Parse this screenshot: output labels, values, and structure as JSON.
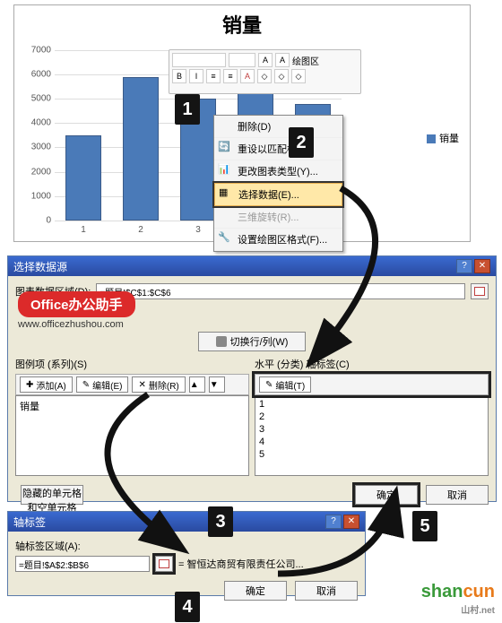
{
  "chart_data": {
    "type": "bar",
    "title": "销量",
    "categories": [
      "1",
      "2",
      "3",
      "4",
      "5"
    ],
    "values": [
      3500,
      5900,
      5000,
      6500,
      4800
    ],
    "ylim": [
      0,
      7000
    ],
    "yticks": [
      0,
      1000,
      2000,
      3000,
      4000,
      5000,
      6000,
      7000
    ],
    "legend": [
      "销量"
    ]
  },
  "mini_toolbar": {
    "area_label": "绘图区",
    "font_buttons": [
      "B",
      "I"
    ],
    "size_btn": "A",
    "btns": [
      "三",
      "≡",
      "A",
      "◇",
      "◇",
      "◇"
    ]
  },
  "context_menu": {
    "items": [
      {
        "label": "删除(D)",
        "icon": ""
      },
      {
        "label": "重设以匹配样",
        "icon": "reset"
      },
      {
        "label": "更改图表类型(Y)...",
        "icon": "chart"
      },
      {
        "label": "选择数据(E)...",
        "icon": "select",
        "highlighted": true
      },
      {
        "label": "三维旋转(R)...",
        "icon": "",
        "disabled": true
      },
      {
        "label": "设置绘图区格式(F)...",
        "icon": "format"
      }
    ]
  },
  "dialog1": {
    "title": "选择数据源",
    "range_label": "图表数据区域(D):",
    "range_value": "=题目!$C$1:$C$6",
    "swap_label": "切换行/列(W)",
    "left": {
      "label": "图例项 (系列)(S)",
      "add_btn": "添加(A)",
      "edit_btn": "编辑(E)",
      "del_btn": "删除(R)",
      "items": [
        "销量"
      ]
    },
    "right": {
      "label": "水平 (分类) 轴标签(C)",
      "edit_btn": "编辑(T)",
      "items": [
        "1",
        "2",
        "3",
        "4",
        "5"
      ]
    },
    "hidden_btn": "隐藏的单元格和空单元格(H)",
    "ok": "确定",
    "cancel": "取消"
  },
  "badge": {
    "text": "Office办公助手",
    "url": "www.officezhushou.com"
  },
  "dialog2": {
    "title": "轴标签",
    "range_label": "轴标签区域(A):",
    "range_value": "=题目!$A$2:$B$6",
    "result_value": "= 智恒达商贸有限责任公司...",
    "ok": "确定",
    "cancel": "取消"
  },
  "steps": {
    "s1": "1",
    "s2": "2",
    "s3": "3",
    "s4": "4",
    "s5": "5"
  },
  "shancun": {
    "part1": "shan",
    "part2": "cun",
    "sub": "山村.net"
  }
}
